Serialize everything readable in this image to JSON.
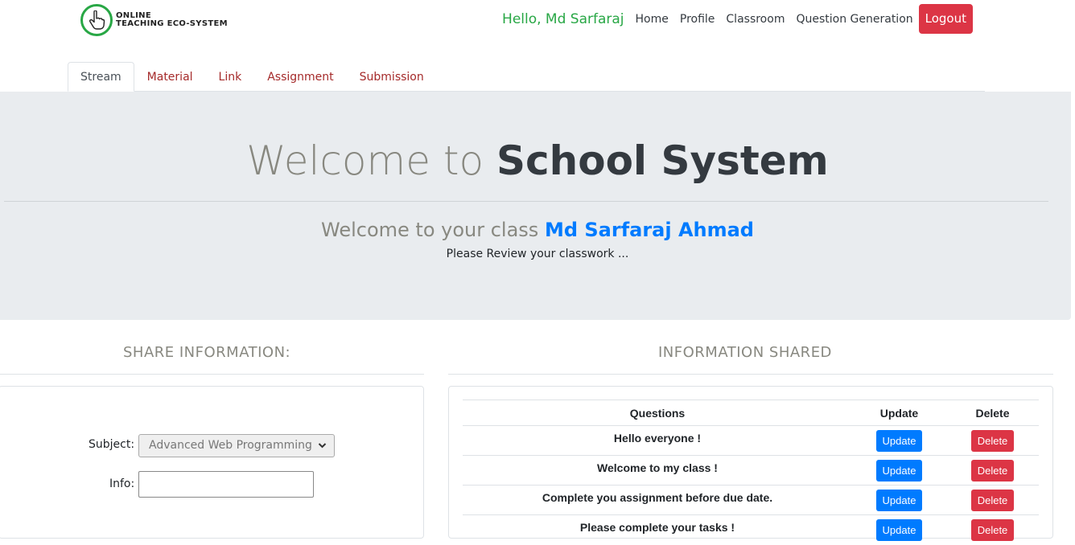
{
  "brand": {
    "line1": "ONLINE",
    "line2": "TEACHING ECO-SYSTEM"
  },
  "nav": {
    "greeting": "Hello, Md Sarfaraj",
    "links": [
      "Home",
      "Profile",
      "Classroom",
      "Question Generation"
    ],
    "logout": "Logout"
  },
  "tabs": [
    "Stream",
    "Material",
    "Link",
    "Assignment",
    "Submission"
  ],
  "jumbotron": {
    "title_light": "Welcome to",
    "title_bold": "School System",
    "sub_light": "Welcome to your class",
    "sub_name": "Md Sarfaraj Ahmad",
    "lead": "Please Review your classwork ..."
  },
  "share": {
    "title": "SHARE INFORMATION:",
    "subject_label": "Subject:",
    "subject_value": "Advanced Web Programming",
    "info_label": "Info:"
  },
  "shared": {
    "title": "INFORMATION SHARED",
    "headers": [
      "Questions",
      "Update",
      "Delete"
    ],
    "rows": [
      {
        "question": "Hello everyone !",
        "update": "Update",
        "delete": "Delete"
      },
      {
        "question": "Welcome to my class !",
        "update": "Update",
        "delete": "Delete"
      },
      {
        "question": "Complete you assignment before due date.",
        "update": "Update",
        "delete": "Delete"
      },
      {
        "question": "Please complete your tasks !",
        "update": "Update",
        "delete": "Delete"
      }
    ]
  }
}
